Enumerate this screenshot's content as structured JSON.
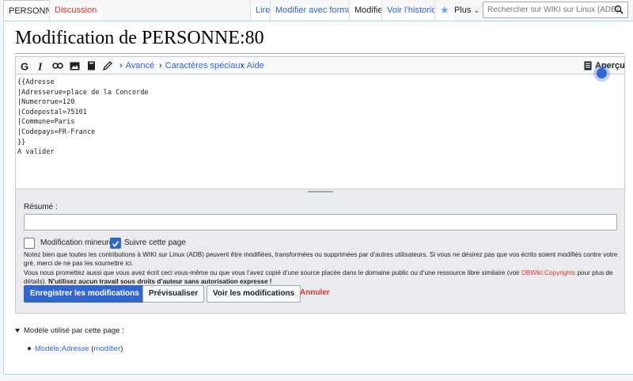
{
  "tabs_left": {
    "page": "PERSONNE",
    "discussion": "Discussion"
  },
  "tabs_right": {
    "read": "Lire",
    "edit_form": "Modifier avec formulaire",
    "edit": "Modifier",
    "history": "Voir l’historique",
    "more": "Plus"
  },
  "search": {
    "placeholder": "Rechercher sur WIKI sur Linux (ADB)"
  },
  "page_title": "Modification de PERSONNE:80",
  "toolbar": {
    "advanced": "Avancé",
    "special_chars": "Caractères spéciaux",
    "help": "Aide",
    "preview": "Aperçu"
  },
  "editor_lines": [
    "{{Adresse",
    "|Adresserue=place de la Concorde",
    "|Numerorue=120",
    "|Codepostal=75101",
    "|Commune=Paris",
    "|Codepays=FR-France",
    "}}",
    "A valider"
  ],
  "summary": {
    "label": "Résumé :",
    "value": ""
  },
  "checkboxes": {
    "minor": {
      "label": "Modification mineure",
      "checked": false
    },
    "watch": {
      "label": "Suivre cette page",
      "checked": true
    }
  },
  "notice": {
    "p1": "Notez bien que toutes les contributions à WIKI sur Linux (ADB) peuvent être modifiées, transformées ou supprimées par d’autres utilisateurs. Si vous ne désirez pas que vos écrits soient modifiés contre votre gré, merci de ne pas les soumettre ici.",
    "p2_start": "Vous nous promettez aussi que vous avez écrit ceci vous-même ou que vous l’avez copié d’une source placée dans le domaine public ou d’une ressource libre similaire (voir ",
    "p2_link": "DBWiki:Copyrights",
    "p2_end": " pour plus de détails).",
    "p2_bold": "N’utilisez aucun travail sous droits d’auteur sans autorisation expresse !"
  },
  "buttons": {
    "save": "Enregistrer les modifications",
    "preview": "Prévisualiser",
    "diff": "Voir les modifications",
    "cancel": "Annuler"
  },
  "templates": {
    "heading": "Modèle utilisé par cette page :",
    "items": [
      {
        "name": "Modèle:Adresse",
        "action": "modifier"
      }
    ]
  },
  "colors": {
    "link": "#3366cc",
    "red_link": "#dd3333",
    "primary": "#3366cc"
  }
}
